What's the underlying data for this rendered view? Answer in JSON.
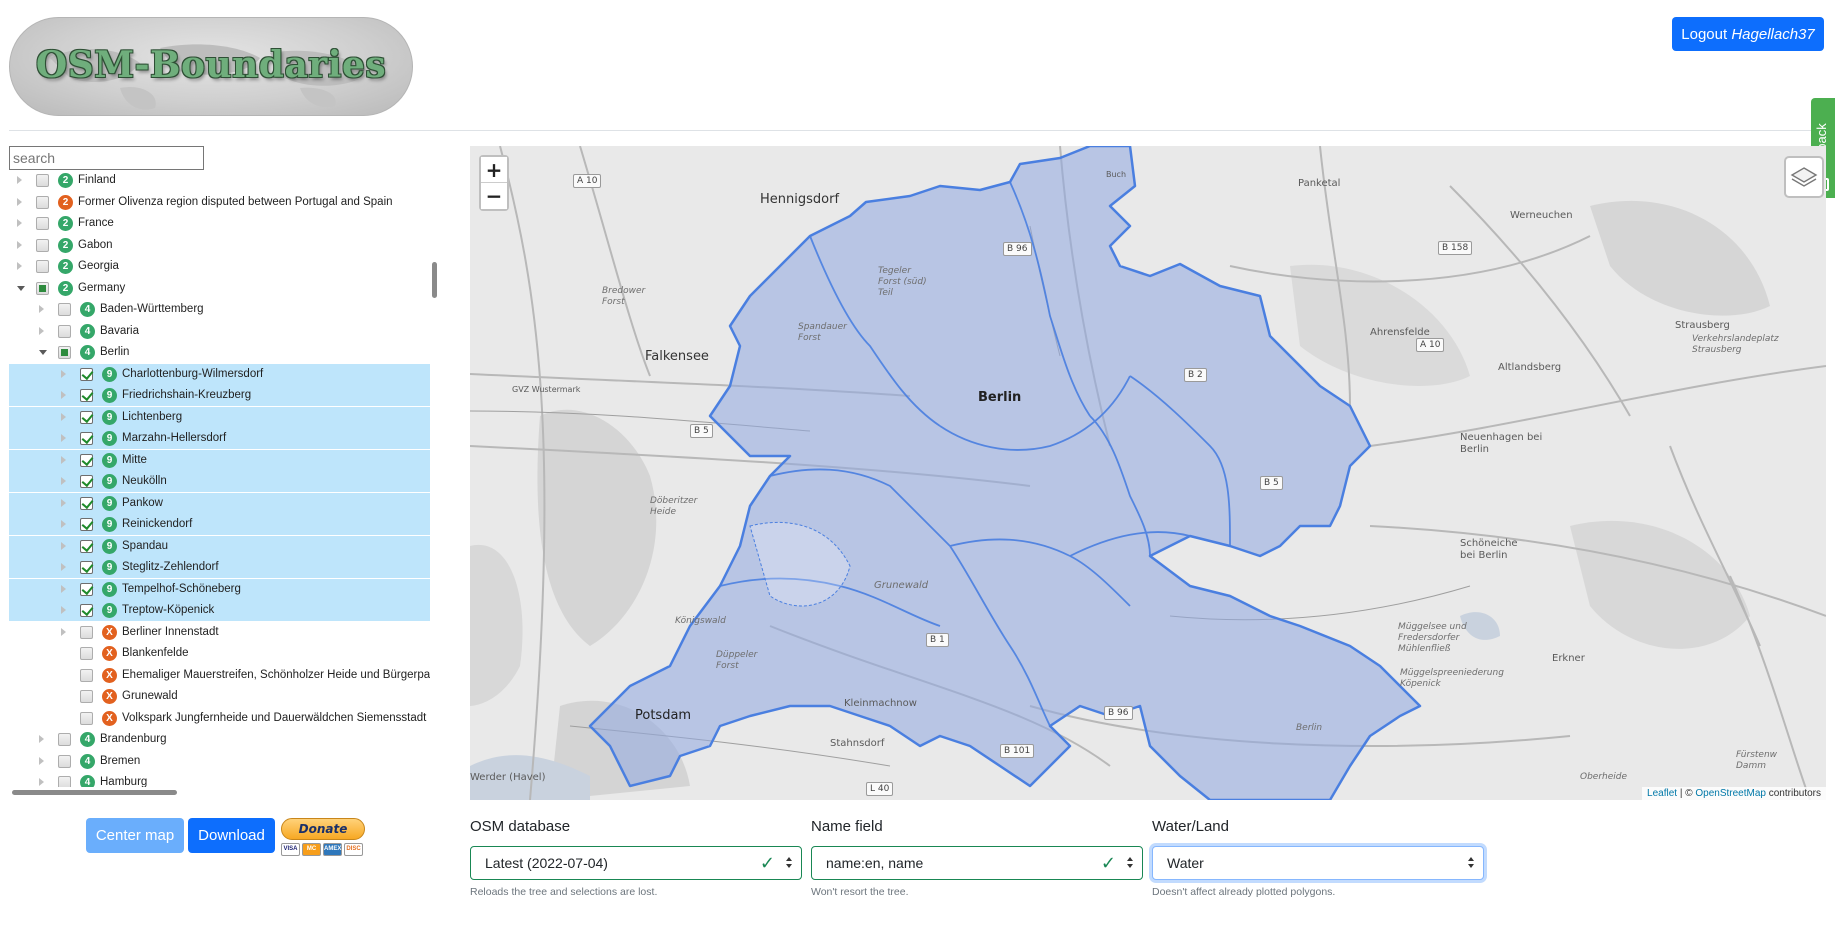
{
  "header": {
    "logo_text": "OSM-Boundaries",
    "logout_label": "Logout",
    "username": "Hagellach37",
    "feedback_label": "feedback"
  },
  "tree": {
    "search_placeholder": "search",
    "items": [
      {
        "label": "Finland",
        "level": "2",
        "depth": 0,
        "state": "unchecked",
        "toggle": "closed",
        "badge": "green"
      },
      {
        "label": "Former Olivenza region disputed between Portugal and Spain",
        "level": "2",
        "depth": 0,
        "state": "unchecked",
        "toggle": "closed",
        "badge": "orange"
      },
      {
        "label": "France",
        "level": "2",
        "depth": 0,
        "state": "unchecked",
        "toggle": "closed",
        "badge": "green"
      },
      {
        "label": "Gabon",
        "level": "2",
        "depth": 0,
        "state": "unchecked",
        "toggle": "closed",
        "badge": "green"
      },
      {
        "label": "Georgia",
        "level": "2",
        "depth": 0,
        "state": "unchecked",
        "toggle": "closed",
        "badge": "green"
      },
      {
        "label": "Germany",
        "level": "2",
        "depth": 0,
        "state": "partial",
        "toggle": "open",
        "badge": "green"
      },
      {
        "label": "Baden-Württemberg",
        "level": "4",
        "depth": 1,
        "state": "unchecked",
        "toggle": "closed",
        "badge": "green"
      },
      {
        "label": "Bavaria",
        "level": "4",
        "depth": 1,
        "state": "unchecked",
        "toggle": "closed",
        "badge": "green"
      },
      {
        "label": "Berlin",
        "level": "4",
        "depth": 1,
        "state": "partial",
        "toggle": "open",
        "badge": "green"
      },
      {
        "label": "Charlottenburg-Wilmersdorf",
        "level": "9",
        "depth": 2,
        "state": "checked",
        "toggle": "closed",
        "badge": "green",
        "selected": true
      },
      {
        "label": "Friedrichshain-Kreuzberg",
        "level": "9",
        "depth": 2,
        "state": "checked",
        "toggle": "closed",
        "badge": "green",
        "selected": true
      },
      {
        "label": "Lichtenberg",
        "level": "9",
        "depth": 2,
        "state": "checked",
        "toggle": "closed",
        "badge": "green",
        "selected": true
      },
      {
        "label": "Marzahn-Hellersdorf",
        "level": "9",
        "depth": 2,
        "state": "checked",
        "toggle": "closed",
        "badge": "green",
        "selected": true
      },
      {
        "label": "Mitte",
        "level": "9",
        "depth": 2,
        "state": "checked",
        "toggle": "closed",
        "badge": "green",
        "selected": true
      },
      {
        "label": "Neukölln",
        "level": "9",
        "depth": 2,
        "state": "checked",
        "toggle": "closed",
        "badge": "green",
        "selected": true
      },
      {
        "label": "Pankow",
        "level": "9",
        "depth": 2,
        "state": "checked",
        "toggle": "closed",
        "badge": "green",
        "selected": true
      },
      {
        "label": "Reinickendorf",
        "level": "9",
        "depth": 2,
        "state": "checked",
        "toggle": "closed",
        "badge": "green",
        "selected": true
      },
      {
        "label": "Spandau",
        "level": "9",
        "depth": 2,
        "state": "checked",
        "toggle": "closed",
        "badge": "green",
        "selected": true
      },
      {
        "label": "Steglitz-Zehlendorf",
        "level": "9",
        "depth": 2,
        "state": "checked",
        "toggle": "closed",
        "badge": "green",
        "selected": true
      },
      {
        "label": "Tempelhof-Schöneberg",
        "level": "9",
        "depth": 2,
        "state": "checked",
        "toggle": "closed",
        "badge": "green",
        "selected": true
      },
      {
        "label": "Treptow-Köpenick",
        "level": "9",
        "depth": 2,
        "state": "checked",
        "toggle": "closed",
        "badge": "green",
        "selected": true
      },
      {
        "label": "Berliner Innenstadt",
        "level": "X",
        "depth": 2,
        "state": "unchecked",
        "toggle": "closed",
        "badge": "orange"
      },
      {
        "label": "Blankenfelde",
        "level": "X",
        "depth": 2,
        "state": "unchecked",
        "toggle": "none",
        "badge": "orange"
      },
      {
        "label": "Ehemaliger Mauerstreifen, Schönholzer Heide und Bürgerpar",
        "level": "X",
        "depth": 2,
        "state": "unchecked",
        "toggle": "none",
        "badge": "orange"
      },
      {
        "label": "Grunewald",
        "level": "X",
        "depth": 2,
        "state": "unchecked",
        "toggle": "none",
        "badge": "orange"
      },
      {
        "label": "Volkspark Jungfernheide und Dauerwäldchen Siemensstadt",
        "level": "X",
        "depth": 2,
        "state": "unchecked",
        "toggle": "none",
        "badge": "orange"
      },
      {
        "label": "Brandenburg",
        "level": "4",
        "depth": 1,
        "state": "unchecked",
        "toggle": "closed",
        "badge": "green"
      },
      {
        "label": "Bremen",
        "level": "4",
        "depth": 1,
        "state": "unchecked",
        "toggle": "closed",
        "badge": "green"
      },
      {
        "label": "Hamburg",
        "level": "4",
        "depth": 1,
        "state": "unchecked",
        "toggle": "closed",
        "badge": "green"
      }
    ]
  },
  "buttons": {
    "center_map": "Center map",
    "download": "Download",
    "donate": "Donate",
    "cards": [
      "VISA",
      "MC",
      "AMEX",
      "DISC"
    ]
  },
  "map": {
    "zoom_in": "+",
    "zoom_out": "−",
    "attribution_leaflet": "Leaflet",
    "attribution_sep": " | © ",
    "attribution_osm": "OpenStreetMap",
    "attribution_tail": " contributors",
    "labels": {
      "city": "Berlin",
      "hennigsdorf": "Hennigsdorf",
      "falkensee": "Falkensee",
      "potsdam": "Potsdam",
      "kleinmachnow": "Kleinmachnow",
      "stahnsdorf": "Stahnsdorf",
      "panketal": "Panketal",
      "werneuchen": "Werneuchen",
      "ahrensfelde": "Ahrensfelde",
      "altlandsberg": "Altlandsberg",
      "strausberg": "Strausberg",
      "neuenhagen": "Neuenhagen bei Berlin",
      "schoeneiche": "Schöneiche bei Berlin",
      "erkner": "Erkner",
      "werder": "Werder (Havel)",
      "gvz": "GVZ Wustermark",
      "buch": "Buch",
      "berlin_small": "Berlin",
      "grunewald": "Grunewald",
      "doeberitzer": "Döberitzer Heide",
      "spandauer_forst": "Spandauer Forst",
      "tegeler_forst": "Tegeler Forst (süd) Teil",
      "bredower": "Bredower Forst",
      "duppeler": "Düppeler Forst",
      "koenigswald": "Königswald",
      "mueggelsee": "Müggelsee und Fredersdorfer Mühlenfließ",
      "mueggelspree": "Müggelspreeniederung Köpenick",
      "verkehrslande": "Verkehrslandeplatz Strausberg",
      "oberheide": "Oberheide",
      "fuerstenwalde": "Fürstenw Damm"
    },
    "shields": {
      "a10a": "A 10",
      "a10b": "A 10",
      "b96a": "B 96",
      "b96b": "B 96",
      "b2": "B 2",
      "b5a": "B 5",
      "b5b": "B 5",
      "b1": "B 1",
      "b101": "B 101",
      "b158": "B 158",
      "l40": "L 40"
    }
  },
  "controls": {
    "db_label": "OSM database",
    "db_value": "Latest (2022-07-04)",
    "db_help": "Reloads the tree and selections are lost.",
    "name_label": "Name field",
    "name_value": "name:en, name",
    "name_help": "Won't resort the tree.",
    "water_label": "Water/Land",
    "water_value": "Water",
    "water_help": "Doesn't affect already plotted polygons."
  },
  "colors": {
    "accent": "#0d6efd",
    "selected_row": "#bee5fb",
    "boundary_stroke": "#4a7fe0",
    "boundary_fill": "#8fa8e0",
    "valid": "#198754"
  }
}
